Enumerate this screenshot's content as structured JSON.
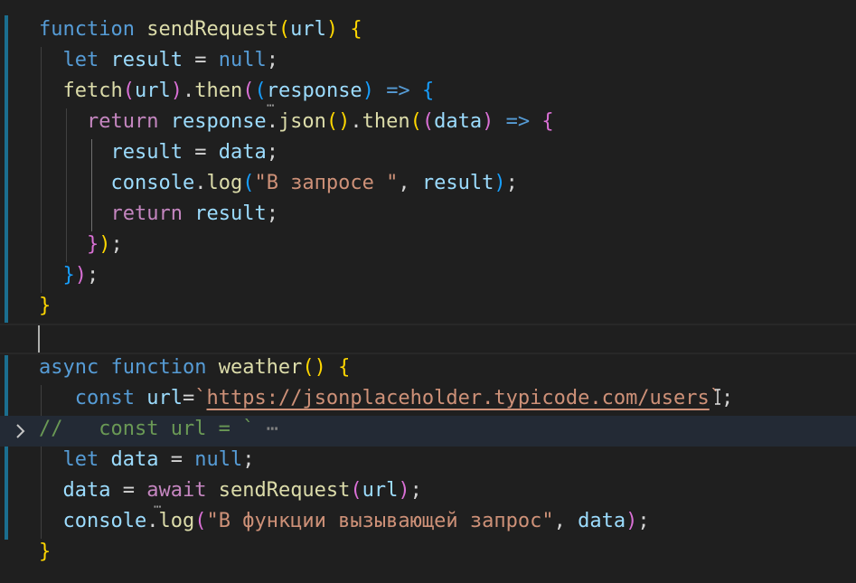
{
  "editor": {
    "lines": [
      {
        "tokens": [
          [
            "kw",
            "function"
          ],
          [
            "punc",
            " "
          ],
          [
            "fn",
            "sendRequest"
          ],
          [
            "br1",
            "("
          ],
          [
            "var",
            "url"
          ],
          [
            "br1",
            ")"
          ],
          [
            "punc",
            " "
          ],
          [
            "br1",
            "{"
          ]
        ]
      },
      {
        "tokens": [
          [
            "punc",
            "  "
          ],
          [
            "kw",
            "let"
          ],
          [
            "punc",
            " "
          ],
          [
            "var",
            "result"
          ],
          [
            "punc",
            " = "
          ],
          [
            "kw",
            "null"
          ],
          [
            "punc",
            ";"
          ]
        ]
      },
      {
        "tokens": [
          [
            "punc",
            "  "
          ],
          [
            "fn",
            "fetch"
          ],
          [
            "br2",
            "("
          ],
          [
            "var",
            "url"
          ],
          [
            "br2",
            ")"
          ],
          [
            "punc",
            "."
          ],
          [
            "fn",
            "then"
          ],
          [
            "br2",
            "("
          ],
          [
            "br3",
            "("
          ],
          [
            "var",
            "response"
          ],
          [
            "br3",
            ")"
          ],
          [
            "punc",
            " "
          ],
          [
            "kw",
            "=>"
          ],
          [
            "punc",
            " "
          ],
          [
            "br3",
            "{"
          ]
        ]
      },
      {
        "tokens": [
          [
            "punc",
            "    "
          ],
          [
            "ctrl",
            "return"
          ],
          [
            "punc",
            " "
          ],
          [
            "var",
            "response"
          ],
          [
            "punc",
            "."
          ],
          [
            "fn",
            "json"
          ],
          [
            "br1",
            "()"
          ],
          [
            "punc",
            "."
          ],
          [
            "fn",
            "then"
          ],
          [
            "br1",
            "("
          ],
          [
            "br2",
            "("
          ],
          [
            "var",
            "data"
          ],
          [
            "br2",
            ")"
          ],
          [
            "punc",
            " "
          ],
          [
            "kw",
            "=>"
          ],
          [
            "punc",
            " "
          ],
          [
            "br2",
            "{"
          ]
        ]
      },
      {
        "tokens": [
          [
            "punc",
            "      "
          ],
          [
            "var",
            "result"
          ],
          [
            "punc",
            " = "
          ],
          [
            "var",
            "data"
          ],
          [
            "punc",
            ";"
          ]
        ]
      },
      {
        "tokens": [
          [
            "punc",
            "      "
          ],
          [
            "var",
            "console"
          ],
          [
            "punc",
            "."
          ],
          [
            "fn",
            "log"
          ],
          [
            "br3",
            "("
          ],
          [
            "str",
            "\"В запросе \""
          ],
          [
            "punc",
            ", "
          ],
          [
            "var",
            "result"
          ],
          [
            "br3",
            ")"
          ],
          [
            "punc",
            ";"
          ]
        ]
      },
      {
        "tokens": [
          [
            "punc",
            "      "
          ],
          [
            "ctrl",
            "return"
          ],
          [
            "punc",
            " "
          ],
          [
            "var",
            "result"
          ],
          [
            "punc",
            ";"
          ]
        ]
      },
      {
        "tokens": [
          [
            "punc",
            "    "
          ],
          [
            "br2",
            "}"
          ],
          [
            "br1",
            ")"
          ],
          [
            "punc",
            ";"
          ]
        ]
      },
      {
        "tokens": [
          [
            "punc",
            "  "
          ],
          [
            "br3",
            "}"
          ],
          [
            "br2",
            ")"
          ],
          [
            "punc",
            ";"
          ]
        ]
      },
      {
        "tokens": [
          [
            "br1",
            "}"
          ]
        ]
      },
      {
        "tokens": []
      },
      {
        "tokens": [
          [
            "kw",
            "async"
          ],
          [
            "punc",
            " "
          ],
          [
            "kw",
            "function"
          ],
          [
            "punc",
            " "
          ],
          [
            "fn",
            "weather"
          ],
          [
            "br1",
            "()"
          ],
          [
            "punc",
            " "
          ],
          [
            "br1",
            "{"
          ]
        ]
      },
      {
        "tokens": [
          [
            "punc",
            "   "
          ],
          [
            "kw",
            "const"
          ],
          [
            "punc",
            " "
          ],
          [
            "var",
            "url"
          ],
          [
            "punc",
            "="
          ],
          [
            "str",
            "`"
          ],
          [
            "str",
            "https://jsonplaceholder.typicode.com/users",
            "link"
          ],
          [
            "str",
            "`"
          ],
          [
            "punc",
            ";"
          ]
        ]
      },
      {
        "tokens": [
          [
            "cmt",
            "//   const url = `"
          ],
          [
            "ellipsis",
            " ⋯"
          ]
        ]
      },
      {
        "tokens": [
          [
            "punc",
            "  "
          ],
          [
            "kw",
            "let"
          ],
          [
            "punc",
            " "
          ],
          [
            "var",
            "data"
          ],
          [
            "punc",
            " = "
          ],
          [
            "kw",
            "null"
          ],
          [
            "punc",
            ";"
          ]
        ]
      },
      {
        "tokens": [
          [
            "punc",
            "  "
          ],
          [
            "var",
            "data"
          ],
          [
            "punc",
            " = "
          ],
          [
            "ctrl",
            "await"
          ],
          [
            "punc",
            " "
          ],
          [
            "fn",
            "sendRequest"
          ],
          [
            "br2",
            "("
          ],
          [
            "var",
            "url"
          ],
          [
            "br2",
            ")"
          ],
          [
            "punc",
            ";"
          ]
        ]
      },
      {
        "tokens": [
          [
            "punc",
            "  "
          ],
          [
            "var",
            "console"
          ],
          [
            "punc",
            "."
          ],
          [
            "fn",
            "log"
          ],
          [
            "br2",
            "("
          ],
          [
            "str",
            "\"В функции вызывающей запрос\""
          ],
          [
            "punc",
            ", "
          ],
          [
            "var",
            "data"
          ],
          [
            "br2",
            ")"
          ],
          [
            "punc",
            ";"
          ]
        ]
      },
      {
        "tokens": [
          [
            "br1",
            "}"
          ]
        ]
      }
    ],
    "fold_icon": "chevron-right-icon"
  }
}
